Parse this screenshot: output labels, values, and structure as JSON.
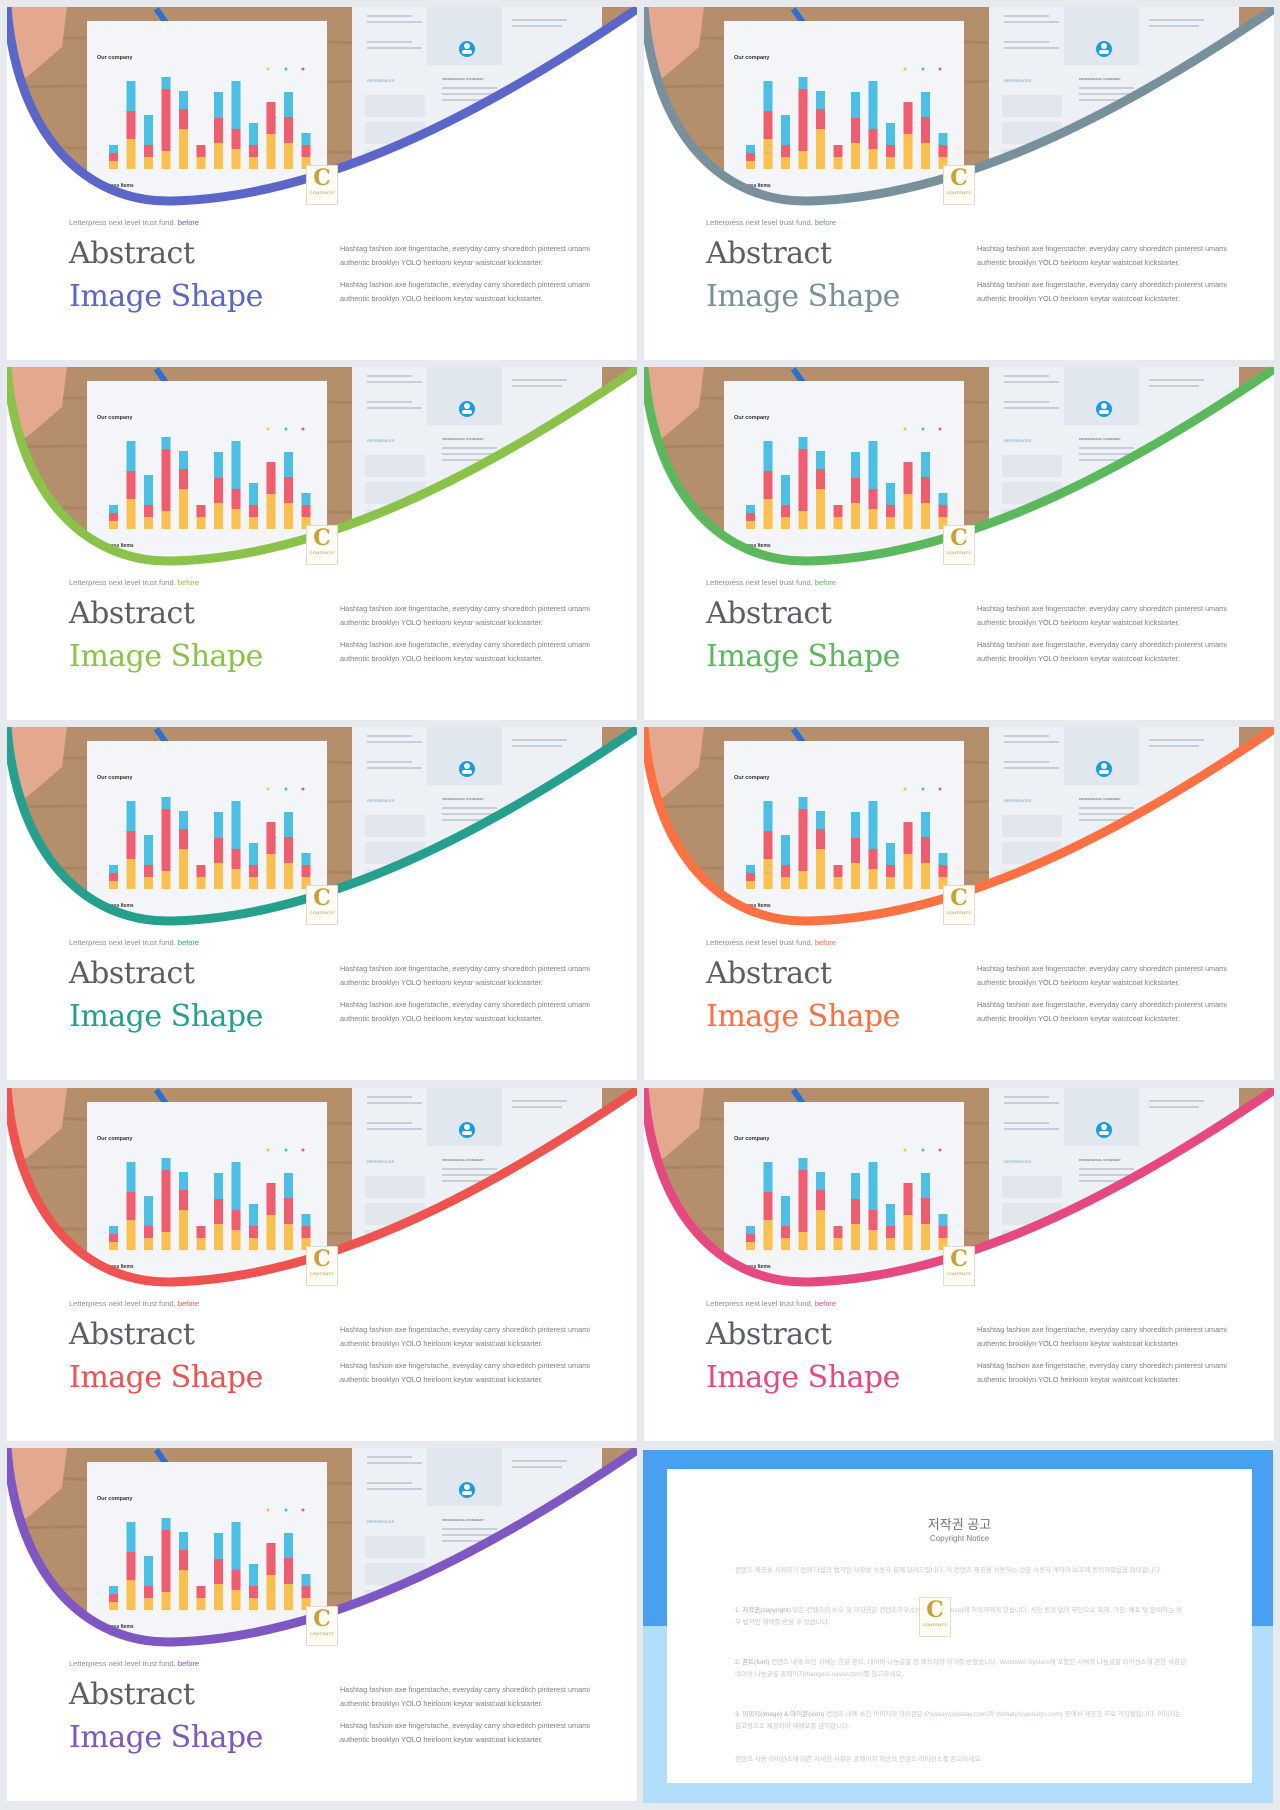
{
  "slides": [
    {
      "accent": "#5b67c8"
    },
    {
      "accent": "#78909c"
    },
    {
      "accent": "#8bc34a"
    },
    {
      "accent": "#5cb85c"
    },
    {
      "accent": "#26a08e"
    },
    {
      "accent": "#ff7043"
    },
    {
      "accent": "#ef5350"
    },
    {
      "accent": "#e64980"
    },
    {
      "accent": "#7e57c2"
    }
  ],
  "slide_text": {
    "subtitle_prefix": "Letterpress next level trust fund, ",
    "subtitle_accent": "before",
    "title_line1": "Abstract",
    "title_line2": "Image Shape",
    "para1": "Hashtag fashion axe fingerstache, everyday carry shoreditch pinterest umami authentic brooklyn YOLO heirloom keytar waistcoat kickstarter.",
    "para2": "Hashtag fashion axe fingerstache, everyday carry shoreditch pinterest umami authentic brooklyn YOLO heirloom keytar waistcoat kickstarter."
  },
  "photo_text": {
    "chart_title": "Our company",
    "chart2_title": "Business Items",
    "references": "REFERENCES",
    "statement": "PROFESSIONAL STATEMENT"
  },
  "logo": {
    "letter": "C",
    "text": "CONTENTS"
  },
  "copyright": {
    "title": "저작권 공고",
    "subtitle": "Copyright Notice",
    "intro": "컨텐츠 제공을 시작하기 전에 다음의 법적인 사항을 사용자 분께 알려드립니다. 이 컨텐츠 제공을 사용하는 것은 사용자 계약의 보호에 동의하였음을 의미합니다.",
    "items": [
      {
        "label": "1. 저작권(copyright)",
        "text": " 모든 컨텐츠의 소유 및 저작권은 컨텐츠하우스(Contentshouse)에 저작자에게 있습니다. 사전 동의 없이 무단으로 복제, 가공, 배포 및 판매하는 경우 법적인 제재를 받을 수 있습니다."
      },
      {
        "label": "2. 폰트(font)",
        "text": " 컨텐츠 내에 쓰인 서체는 한글 폰트, 네이버 나눔글꼴 등 제작자의 허가를 받았습니다. Windows System에 포함된 서체와 나눔글꼴 라이선스에 관한 사항은 네이버 나눔글꼴 홈페이지(hangeul.naver.com)를 참고하세요."
      },
      {
        "label": "3. 이미지(image) & 아이콘(icon)",
        "text": " 컨텐츠 내에 쓰인 이미지와 아이콘은 Pixabay(pixabay.com)와 Webalys(webalys.com) 등에서 제공한 무료 저작물입니다. 이미지는 참고용으로 제공되며 재배포를 금지합니다."
      }
    ],
    "outro": "컨텐츠 사용 라이선스에 대한 자세한 사항은 홈페이지 하단의 컨텐츠 라이선스를 참고하세요."
  }
}
